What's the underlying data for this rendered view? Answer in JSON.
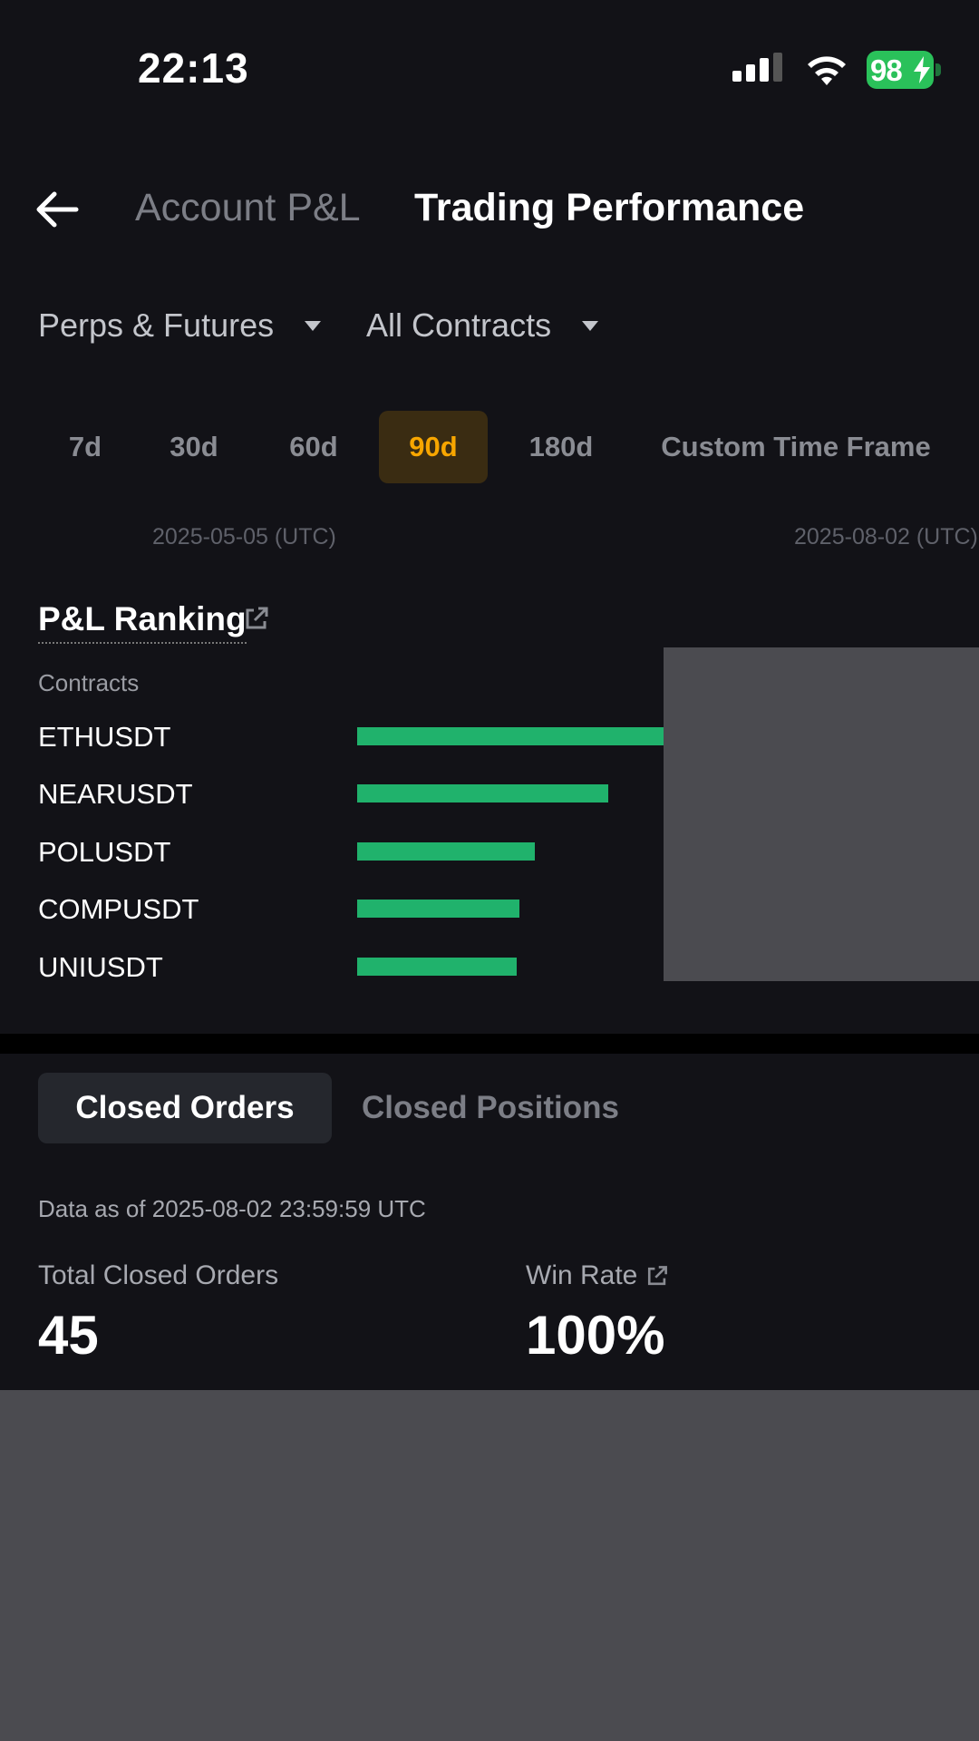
{
  "status_bar": {
    "time": "22:13",
    "battery": "98"
  },
  "header": {
    "tabs": [
      {
        "label": "Account P&L",
        "active": false
      },
      {
        "label": "Trading Performance",
        "active": true
      }
    ]
  },
  "filters": {
    "product": "Perps & Futures",
    "contracts": "All Contracts"
  },
  "periods": [
    {
      "label": "7d",
      "selected": false
    },
    {
      "label": "30d",
      "selected": false
    },
    {
      "label": "60d",
      "selected": false
    },
    {
      "label": "90d",
      "selected": true
    },
    {
      "label": "180d",
      "selected": false
    },
    {
      "label": "Custom Time Frame",
      "selected": false
    }
  ],
  "date_range": {
    "start": "2025-05-05 (UTC)",
    "end": "2025-08-02 (UTC)"
  },
  "ranking": {
    "title": "P&L Ranking",
    "column_header": "Contracts",
    "rows": [
      {
        "label": "ETHUSDT",
        "relative_value": 1.0
      },
      {
        "label": "NEARUSDT",
        "relative_value": 0.82
      },
      {
        "label": "POLUSDT",
        "relative_value": 0.58
      },
      {
        "label": "COMPUSDT",
        "relative_value": 0.53
      },
      {
        "label": "UNIUSDT",
        "relative_value": 0.52
      }
    ]
  },
  "orders": {
    "tabs": [
      {
        "label": "Closed Orders",
        "active": true
      },
      {
        "label": "Closed Positions",
        "active": false
      }
    ],
    "as_of": "Data as of 2025-08-02 23:59:59 UTC",
    "total_closed_label": "Total Closed Orders",
    "total_closed_value": "45",
    "win_rate_label": "Win Rate",
    "win_rate_value": "100%"
  },
  "colors": {
    "background": "#121217",
    "accent": "#f7a600",
    "bar": "#20b26c",
    "battery": "#2ac15a"
  }
}
